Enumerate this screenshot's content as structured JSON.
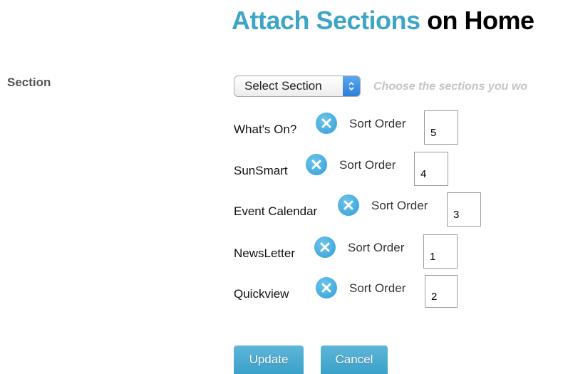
{
  "title": {
    "accent": "Attach Sections",
    "rest": " on Home",
    "accent_color": "#3fa5c6"
  },
  "form": {
    "section_label": "Section",
    "select": {
      "selected": "Select Section",
      "icon": "select-arrows-icon"
    },
    "hint": "Choose the sections you wo"
  },
  "sections": [
    {
      "name": "What's On?",
      "sort_label": "Sort Order",
      "sort_value": "5",
      "remove_icon": "remove-icon"
    },
    {
      "name": "SunSmart",
      "sort_label": "Sort Order",
      "sort_value": "4",
      "remove_icon": "remove-icon"
    },
    {
      "name": "Event Calendar",
      "sort_label": "Sort Order",
      "sort_value": "3",
      "remove_icon": "remove-icon"
    },
    {
      "name": "NewsLetter",
      "sort_label": "Sort Order",
      "sort_value": "1",
      "remove_icon": "remove-icon"
    },
    {
      "name": "Quickview",
      "sort_label": "Sort Order",
      "sort_value": "2",
      "remove_icon": "remove-icon"
    }
  ],
  "actions": {
    "update_label": "Update",
    "cancel_label": "Cancel",
    "button_color": "#4aaad0"
  }
}
